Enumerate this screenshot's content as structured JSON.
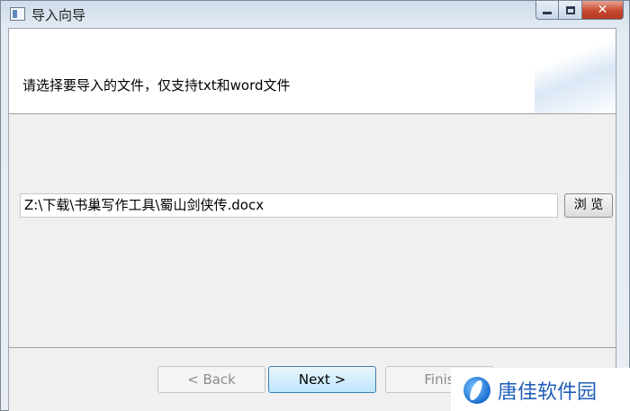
{
  "window": {
    "title": "导入向导"
  },
  "header": {
    "instruction": "请选择要导入的文件，仅支持txt和word文件"
  },
  "file": {
    "path": "Z:\\下载\\书巢写作工具\\蜀山剑侠传.docx",
    "browse_label": "浏 览"
  },
  "nav": {
    "back_label": "< Back",
    "next_label": "Next >",
    "finish_label": "Finis"
  },
  "watermark": {
    "text": "唐佳软件园"
  }
}
